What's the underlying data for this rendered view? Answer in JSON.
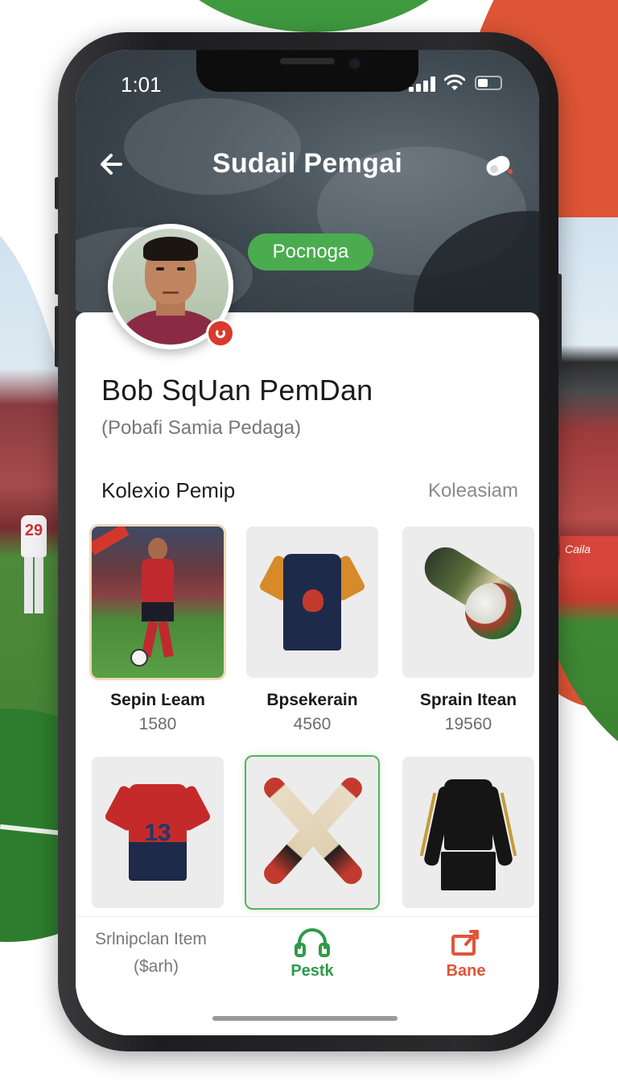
{
  "status_bar": {
    "time": "1:01"
  },
  "header": {
    "title": "Sudail Pemgai",
    "back_icon": "arrow-left-icon",
    "action_icon": "toggle-switch-icon"
  },
  "profile": {
    "badge": "Pocnoga",
    "name": "Bob SqUan PemDan",
    "subtitle": "(Pobafi Samia Pedaga)"
  },
  "collection": {
    "title": "Kolexio Pemip",
    "link": "Koleasiam",
    "items": [
      {
        "name": "Sepin Ŀeam",
        "price": "1580"
      },
      {
        "name": "Bpsekerain",
        "price": "4560"
      },
      {
        "name": "Sprain Itean",
        "price": "19560"
      },
      {
        "name": "",
        "price": ""
      },
      {
        "name": "",
        "price": ""
      },
      {
        "name": "",
        "price": ""
      }
    ]
  },
  "bottom_nav": {
    "left_line1": "Srlnipclan Item",
    "left_line2": "($arh)",
    "middle_label": "Pestk",
    "middle_icon": "headset-icon",
    "right_label": "Bane",
    "right_icon": "export-icon"
  },
  "colors": {
    "accent_green": "#4aac4e",
    "accent_red": "#e0553a",
    "live_red": "#d83a2c"
  }
}
